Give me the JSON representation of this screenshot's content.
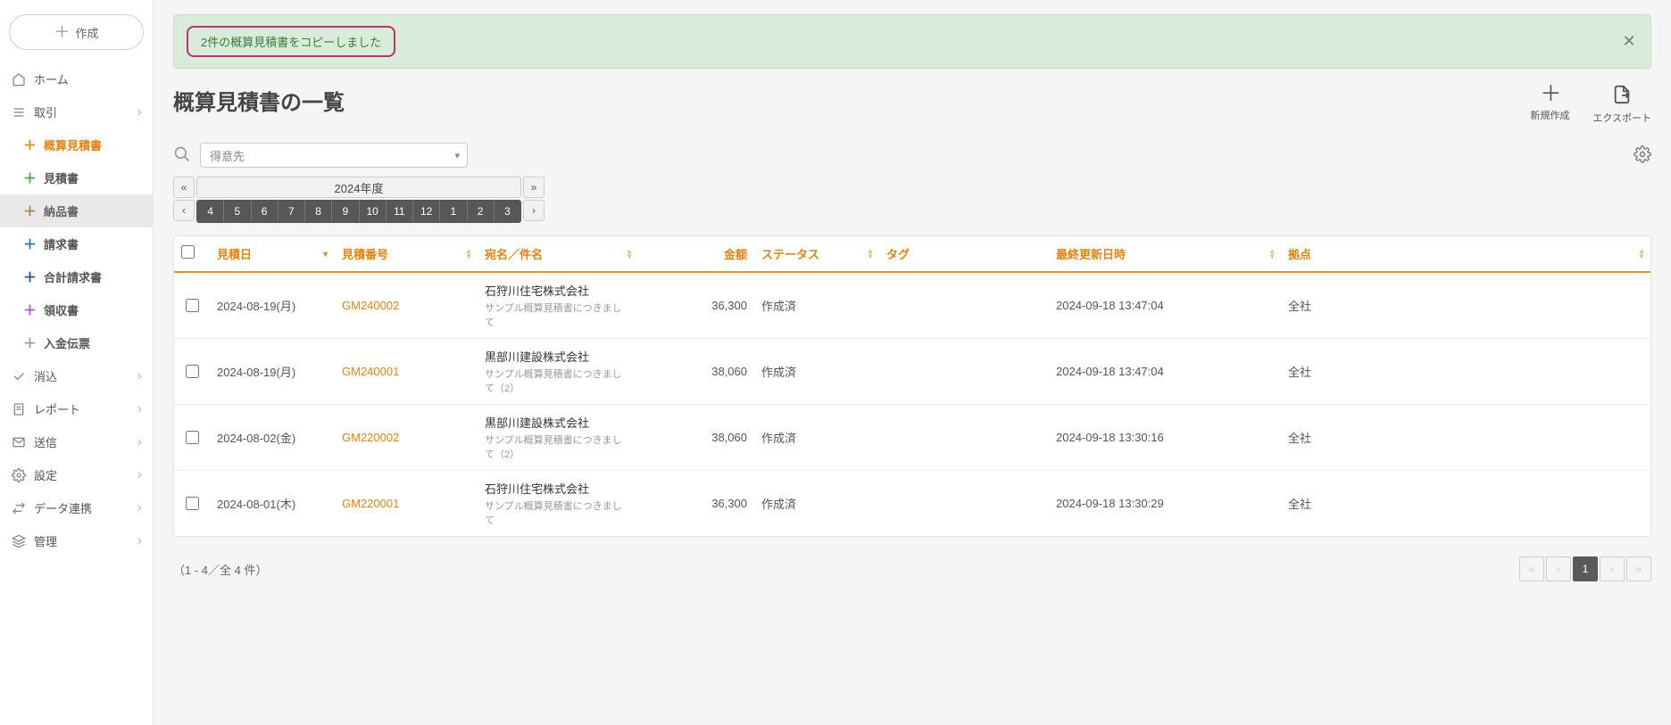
{
  "sidebar": {
    "create_label": "作成",
    "home": "ホーム",
    "transactions": "取引",
    "sub": {
      "estimate_rough": "概算見積書",
      "estimate": "見積書",
      "delivery": "納品書",
      "invoice": "請求書",
      "total_invoice": "合計請求書",
      "receipt": "領収書",
      "deposit": "入金伝票"
    },
    "clear": "消込",
    "report": "レポート",
    "send": "送信",
    "settings": "設定",
    "data_link": "データ連携",
    "manage": "管理"
  },
  "banner": {
    "message": "2件の概算見積書をコピーしました"
  },
  "page": {
    "title": "概算見積書の一覧",
    "new_label": "新規作成",
    "export_label": "エクスポート"
  },
  "filter": {
    "placeholder": "得意先"
  },
  "period": {
    "year_label": "2024年度",
    "months": [
      "4",
      "5",
      "6",
      "7",
      "8",
      "9",
      "10",
      "11",
      "12",
      "1",
      "2",
      "3"
    ]
  },
  "table": {
    "headers": {
      "date": "見積日",
      "number": "見積番号",
      "addressee": "宛名／件名",
      "amount": "金額",
      "status": "ステータス",
      "tag": "タグ",
      "updated": "最終更新日時",
      "base": "拠点"
    },
    "rows": [
      {
        "date": "2024-08-19(月)",
        "number": "GM240002",
        "addr_main": "石狩川住宅株式会社",
        "addr_sub": "サンプル概算見積書につきまして",
        "amount": "36,300",
        "status": "作成済",
        "tag": "",
        "updated": "2024-09-18 13:47:04",
        "base": "全社"
      },
      {
        "date": "2024-08-19(月)",
        "number": "GM240001",
        "addr_main": "黒部川建設株式会社",
        "addr_sub": "サンプル概算見積書につきまして（2）",
        "amount": "38,060",
        "status": "作成済",
        "tag": "",
        "updated": "2024-09-18 13:47:04",
        "base": "全社"
      },
      {
        "date": "2024-08-02(金)",
        "number": "GM220002",
        "addr_main": "黒部川建設株式会社",
        "addr_sub": "サンプル概算見積書につきまして（2）",
        "amount": "38,060",
        "status": "作成済",
        "tag": "",
        "updated": "2024-09-18 13:30:16",
        "base": "全社"
      },
      {
        "date": "2024-08-01(木)",
        "number": "GM220001",
        "addr_main": "石狩川住宅株式会社",
        "addr_sub": "サンプル概算見積書につきまして",
        "amount": "36,300",
        "status": "作成済",
        "tag": "",
        "updated": "2024-09-18 13:30:29",
        "base": "全社"
      }
    ]
  },
  "footer": {
    "count": "（1 - 4／全 4 件）",
    "current_page": "1"
  }
}
